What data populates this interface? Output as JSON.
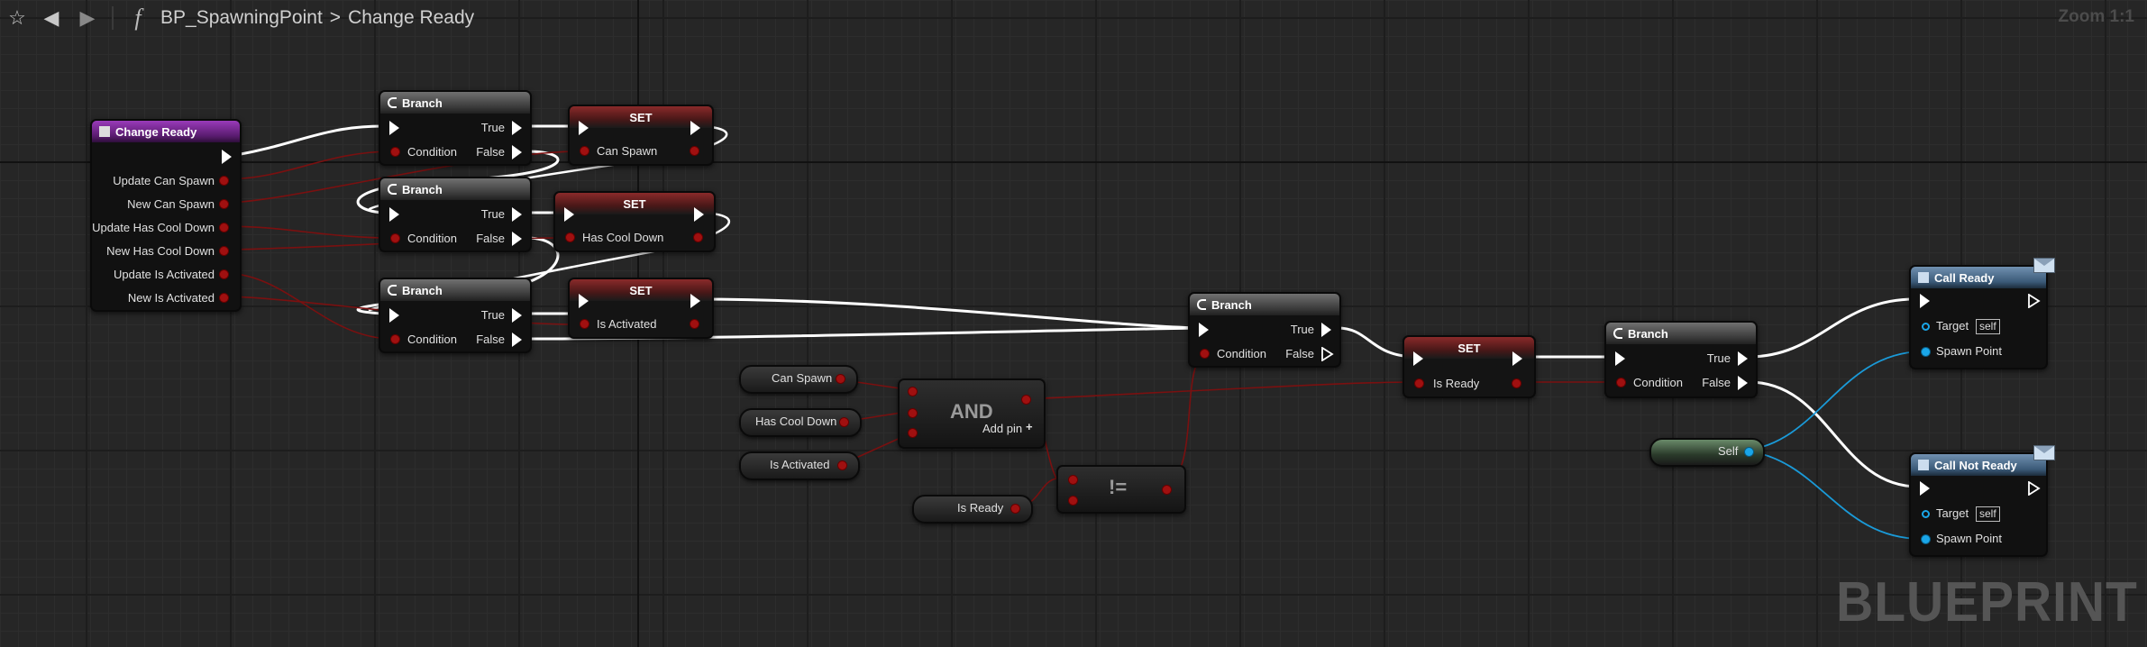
{
  "breadcrumb": {
    "blueprint": "BP_SpawningPoint",
    "separator": ">",
    "function": "Change Ready",
    "function_glyph": "f"
  },
  "zoom": "Zoom 1:1",
  "watermark": "BLUEPRINT",
  "colors": {
    "exec": "#ffffff",
    "bool": "#a01010",
    "object": "#1aa6e8",
    "function_header": "#7a2a96",
    "branch_header": "#5a5a5a",
    "set_header": "#6a2020"
  },
  "entry_node": {
    "title": "Change Ready",
    "params": [
      "Update Can Spawn",
      "New Can Spawn",
      "Update Has Cool Down",
      "New Has Cool Down",
      "Update Is Activated",
      "New Is Activated"
    ]
  },
  "branch_nodes": [
    {
      "title": "Branch",
      "condition": "Condition",
      "true": "True",
      "false": "False"
    },
    {
      "title": "Branch",
      "condition": "Condition",
      "true": "True",
      "false": "False"
    },
    {
      "title": "Branch",
      "condition": "Condition",
      "true": "True",
      "false": "False"
    },
    {
      "title": "Branch",
      "condition": "Condition",
      "true": "True",
      "false": "False"
    },
    {
      "title": "Branch",
      "condition": "Condition",
      "true": "True",
      "false": "False"
    }
  ],
  "set_nodes": [
    {
      "title": "SET",
      "var": "Can Spawn"
    },
    {
      "title": "SET",
      "var": "Has Cool Down"
    },
    {
      "title": "SET",
      "var": "Is Activated"
    },
    {
      "title": "SET",
      "var": "Is Ready"
    }
  ],
  "get_nodes": [
    "Can Spawn",
    "Has Cool Down",
    "Is Activated",
    "Is Ready"
  ],
  "and_node": {
    "title": "AND",
    "add_pin": "Add pin",
    "plus": "+"
  },
  "neq_node": {
    "title": "!="
  },
  "self_node": {
    "label": "Self"
  },
  "call_nodes": [
    {
      "title": "Call Ready",
      "target": "Target",
      "target_value": "self",
      "param": "Spawn Point"
    },
    {
      "title": "Call Not Ready",
      "target": "Target",
      "target_value": "self",
      "param": "Spawn Point"
    }
  ]
}
